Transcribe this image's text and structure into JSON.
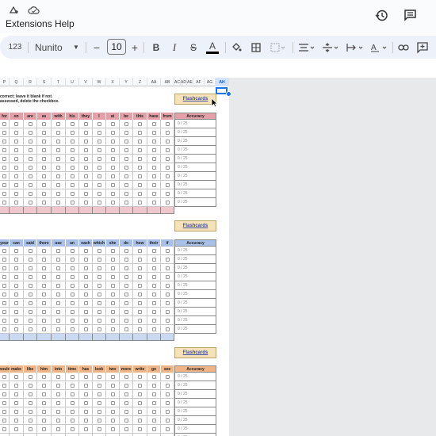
{
  "menu": {
    "extensions": "Extensions",
    "help": "Help"
  },
  "toolbar": {
    "number_format": "123",
    "font": "Nunito",
    "font_size": "10",
    "bold": "B",
    "italic": "I",
    "strike": "S",
    "text_color": "A"
  },
  "columns": [
    "P",
    "Q",
    "R",
    "S",
    "T",
    "U",
    "V",
    "W",
    "X",
    "Y",
    "Z",
    "AA",
    "AB",
    "AC",
    "AD",
    "AE",
    "AF",
    "AG",
    "AH"
  ],
  "selected_column": "AH",
  "instructions": {
    "line1": "correct; leave it blank if not.",
    "line2": "assessed, delete the checkbox."
  },
  "flash_label": "Flashcards",
  "accuracy_label": "Accuracy",
  "accuracy_value": "0 / 25",
  "sections": [
    {
      "color": "#e4a0a8",
      "light": "#f0c7cc",
      "words": [
        "for",
        "on",
        "are",
        "as",
        "with",
        "his",
        "they",
        "I",
        "at",
        "be",
        "this",
        "have",
        "from"
      ]
    },
    {
      "color": "#a9c1e8",
      "light": "#c9d9f2",
      "words": [
        "your",
        "can",
        "said",
        "there",
        "use",
        "an",
        "each",
        "which",
        "she",
        "do",
        "how",
        "their",
        "if"
      ]
    },
    {
      "color": "#f0b487",
      "light": "#f6d1b6",
      "words": [
        "would",
        "make",
        "like",
        "him",
        "into",
        "time",
        "has",
        "look",
        "two",
        "more",
        "write",
        "go",
        "see"
      ]
    }
  ],
  "colors": {
    "accent": "#1a73e8",
    "flash_bg": "#f5e2b8",
    "sheet_bg": "#e8e9ea"
  }
}
